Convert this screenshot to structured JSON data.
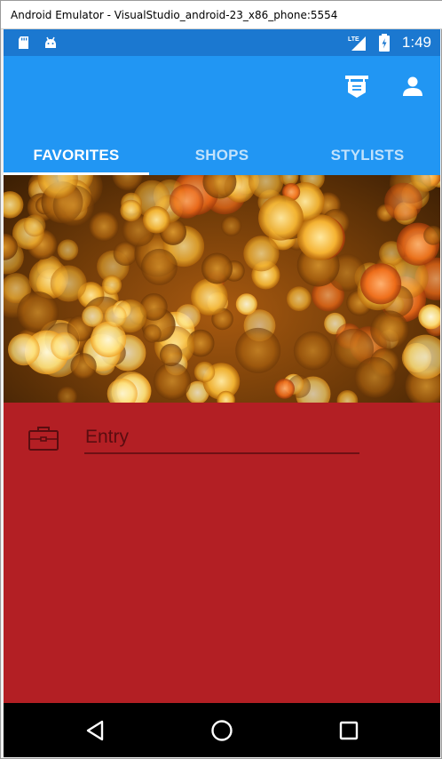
{
  "window": {
    "title": "Android Emulator - VisualStudio_android-23_x86_phone:5554"
  },
  "status_bar": {
    "time": "1:49",
    "network": "LTE"
  },
  "toolbar": {
    "actions": [
      {
        "icon": "store-sign-icon"
      },
      {
        "icon": "person-icon"
      }
    ]
  },
  "tabs": [
    {
      "label": "FAVORITES",
      "active": true
    },
    {
      "label": "SHOPS",
      "active": false
    },
    {
      "label": "STYLISTS",
      "active": false
    }
  ],
  "form": {
    "entry": {
      "placeholder": "Entry",
      "value": ""
    },
    "icon": "briefcase-icon"
  },
  "colors": {
    "app_bar": "#2196f3",
    "status_bar": "#1b78d0",
    "content_background": "#b31f24",
    "nav_bar": "#000000"
  },
  "nav_bar": {
    "buttons": [
      {
        "icon": "back-triangle-icon"
      },
      {
        "icon": "home-circle-icon"
      },
      {
        "icon": "recents-square-icon"
      }
    ]
  }
}
